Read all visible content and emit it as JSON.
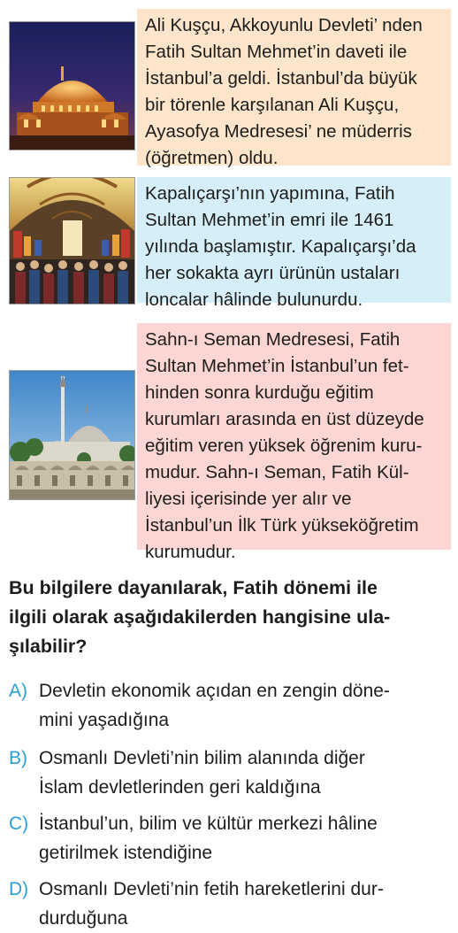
{
  "cards": [
    {
      "image": "hagia-sophia-at-night",
      "text": "Ali Kuşçu, Akkoyunlu Devleti’ nden\nFatih Sultan Mehmet’in daveti ile\nİstanbul’a geldi. İstanbul’da büyük\nbir törenle karşılanan Ali Kuşçu,\nAyasofya Medresesi’ ne müderris\n(öğretmen) oldu.",
      "color": "#fde5cc"
    },
    {
      "image": "grand-bazaar-interior",
      "text": "Kapalıçarşı’nın yapımına, Fatih\nSultan Mehmet’in emri ile 1461\nyılında başlamıştır. Kapalıçarşı’da\nher sokakta ayrı ürünün ustaları\nloncalar hâlinde bulunurdu.",
      "color": "#d5eef8"
    },
    {
      "image": "fatih-mosque-complex",
      "text": "Sahn-ı Seman Medresesi, Fatih\nSultan Mehmet’in İstanbul’un fet-\nhinden sonra kurduğu eğitim\nkurumları arasında en üst düzeyde\neğitim veren yüksek öğrenim kuru-\nmudur. Sahn-ı Seman, Fatih Kül-\nliyesi içerisinde yer alır ve\nİstanbul’un İlk Türk yükseköğretim\nkurumudur.",
      "color": "#fbd6d2"
    }
  ],
  "question": "Bu bilgilere dayanılarak, Fatih dönemi ile\nilgili olarak aşağıdakilerden hangisine ula-\nşılabilir?",
  "options": [
    {
      "letter": "A)",
      "text": "Devletin ekonomik açıdan en zengin döne-\nmini yaşadığına"
    },
    {
      "letter": "B)",
      "text": "Osmanlı Devleti’nin bilim alanında diğer\nİslam devletlerinden geri kaldığına"
    },
    {
      "letter": "C)",
      "text": "İstanbul’un, bilim ve kültür merkezi hâline\ngetirilmek istendiğine"
    },
    {
      "letter": "D)",
      "text": "Osmanlı Devleti’nin fetih hareketlerini dur-\ndurduğuna"
    }
  ],
  "accent_color": "#2a9fd8"
}
